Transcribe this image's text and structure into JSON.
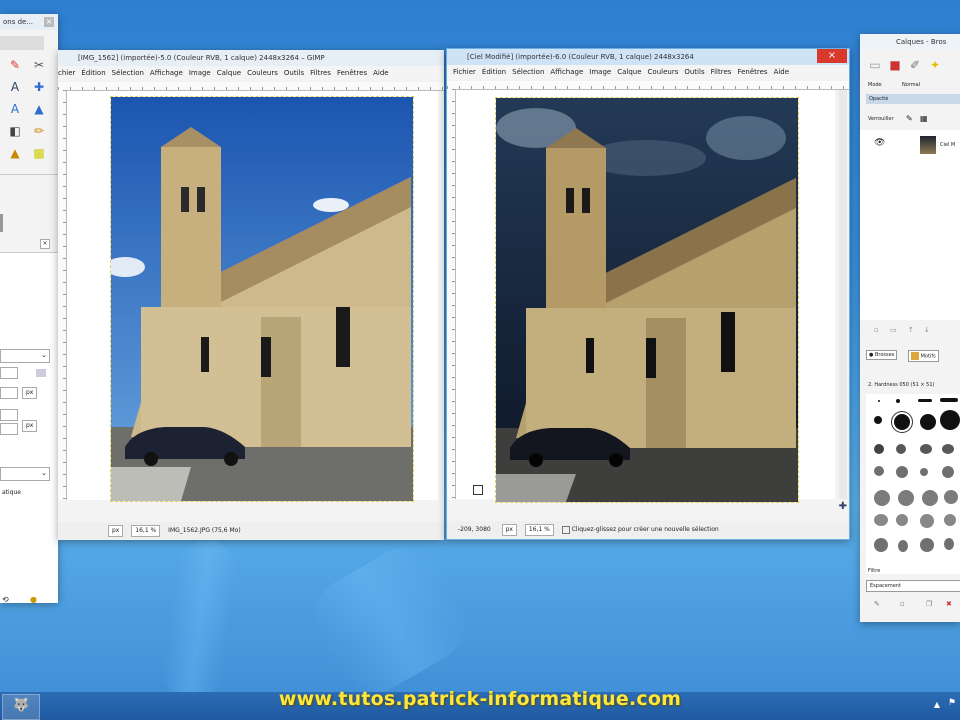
{
  "toolbox": {
    "title": "ons de...",
    "field_empty": "",
    "unit_px": "px",
    "unit_px2": "px",
    "label_atique": "atique"
  },
  "win1": {
    "title": "[IMG_1562] (importée)-5.0 (Couleur RVB, 1 calque) 2448x3264 – GIMP",
    "menu": [
      "chier",
      "Édition",
      "Sélection",
      "Affichage",
      "Image",
      "Calque",
      "Couleurs",
      "Outils",
      "Filtres",
      "Fenêtres",
      "Aide"
    ],
    "status": {
      "unit": "px",
      "zoom": "16,1 %",
      "file": "IMG_1562.JPG (75,6 Mo)"
    }
  },
  "win2": {
    "title": "[Ciel Modifié] (importée)-6.0 (Couleur RVB, 1 calque) 2448x3264",
    "menu": [
      "Fichier",
      "Édition",
      "Sélection",
      "Affichage",
      "Image",
      "Calque",
      "Couleurs",
      "Outils",
      "Filtres",
      "Fenêtres",
      "Aide"
    ],
    "status": {
      "coords": "-209, 3080",
      "unit": "px",
      "zoom": "16,1 %",
      "hint": "Cliquez-glissez pour créer une nouvelle sélection"
    }
  },
  "layers": {
    "title": "Calques - Bros",
    "mode_label": "Mode",
    "mode_value": "Normal",
    "opacity_label": "Opacité",
    "lock_label": "Verrouiller",
    "layer_name": "Ciel M",
    "brush_tab1": "Brosses",
    "brush_tab2": "Motifs",
    "brush_name": "2. Hardness 050 (51 × 51)",
    "filter_label": "Filtre",
    "spacing_label": "Espacement",
    "tag_label": "Étiq"
  },
  "watermark": "www.tutos.patrick-informatique.com"
}
